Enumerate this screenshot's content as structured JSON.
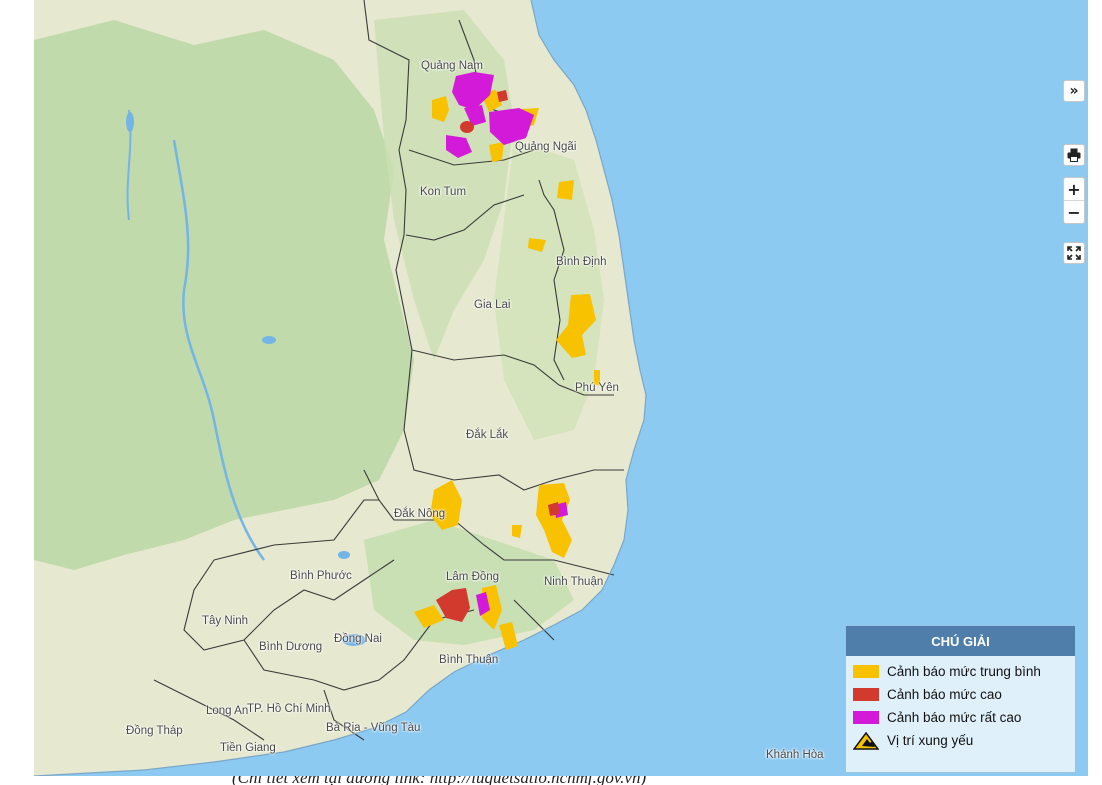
{
  "map": {
    "places": {
      "quang_nam": "Quảng Nam",
      "quang_ngai": "Quảng Ngãi",
      "kon_tum": "Kon Tum",
      "binh_dinh": "Bình Định",
      "gia_lai": "Gia Lai",
      "phu_yen": "Phú Yên",
      "dak_lak": "Đắk Lắk",
      "dak_nong": "Đắk Nông",
      "binh_phuoc": "Bình Phước",
      "lam_dong": "Lâm Đồng",
      "ninh_thuan": "Ninh Thuận",
      "tay_ninh": "Tây Ninh",
      "binh_duong": "Bình Dương",
      "dong_nai": "Đồng Nai",
      "binh_thuan": "Bình Thuận",
      "long_an": "Long An",
      "tp_hcm": "TP. Hồ Chí Minh",
      "dong_thap": "Đồng Tháp",
      "ba_ria": "Bà Rịa - Vũng Tàu",
      "tien_giang": "Tiền Giang",
      "khanh_hoa": "Khánh Hòa"
    },
    "warning_colors": {
      "medium": "#f8c200",
      "high": "#d23a2d",
      "very_high": "#d21ad8"
    }
  },
  "controls": {
    "expand_label": "»",
    "print_icon": "printer-icon",
    "zoom_in_label": "+",
    "zoom_out_label": "−",
    "fullscreen_icon": "fullscreen-icon"
  },
  "legend": {
    "title": "CHÚ GIẢI",
    "items": [
      {
        "label": "Cảnh báo mức trung bình",
        "color": "#f8c200"
      },
      {
        "label": "Cảnh báo mức cao",
        "color": "#d23a2d"
      },
      {
        "label": "Cảnh báo mức rất cao",
        "color": "#d21ad8"
      },
      {
        "label": "Vị trí xung yếu",
        "icon": "landslide-warning-icon"
      }
    ]
  },
  "caption": "(Chi tiết xem tại đường link: http://luquetsatlo.nchmf.gov.vn)"
}
